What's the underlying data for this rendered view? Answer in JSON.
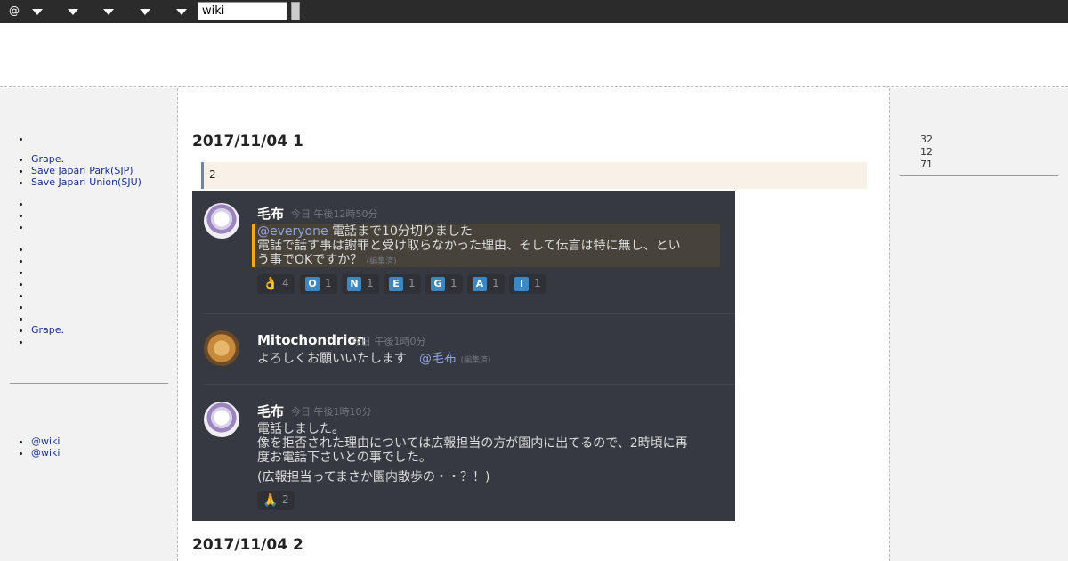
{
  "topbar": {
    "at_label": "@",
    "search_value": "wiki"
  },
  "left_menu": {
    "group1": [
      ""
    ],
    "group2": [
      "Grape.",
      "Save Japari Park(SJP)",
      "Save Japari Union(SJU)"
    ],
    "group3": [
      "",
      "",
      ""
    ],
    "group4": [
      "",
      "",
      "",
      "",
      "",
      "",
      "",
      "Grape.",
      ""
    ],
    "group5": [
      "@wiki",
      "@wiki"
    ]
  },
  "right_counters": [
    "32",
    "12",
    "71"
  ],
  "main": {
    "heading1": "2017/11/04 1",
    "note": "2",
    "heading2": "2017/11/04 2"
  },
  "discord": {
    "messages": [
      {
        "author": "毛布",
        "timestamp": "今日 午後12時50分",
        "mention": "@everyone",
        "line1": "電話まで10分切りました",
        "line2": "電話で話す事は謝罪と受け取らなかった理由、そして伝言は特に無し、とい",
        "line3": "う事でOKですか？",
        "edited": "(編集済)",
        "reactions": [
          {
            "emoji": "👌",
            "count": "4"
          },
          {
            "emoji": "O",
            "count": "1"
          },
          {
            "emoji": "N",
            "count": "1"
          },
          {
            "emoji": "E",
            "count": "1"
          },
          {
            "emoji": "G",
            "count": "1"
          },
          {
            "emoji": "A",
            "count": "1"
          },
          {
            "emoji": "I",
            "count": "1"
          }
        ]
      },
      {
        "author": "Mitochondrion",
        "timestamp": "今日 午後1時0分",
        "text": "よろしくお願いいたします",
        "mention": "@毛布",
        "edited": "(編集済)"
      },
      {
        "author": "毛布",
        "timestamp": "今日 午後1時10分",
        "line1": "電話しました。",
        "line2": "像を拒否された理由については広報担当の方が園内に出てるので、2時頃に再",
        "line3": "度お電話下さいとの事でした。",
        "line4": "(広報担当ってまさか園内散歩の・・？！)",
        "reactions": [
          {
            "emoji": "🙏",
            "count": "2"
          }
        ]
      }
    ]
  }
}
